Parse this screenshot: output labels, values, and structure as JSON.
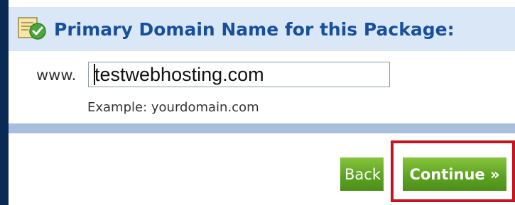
{
  "header": {
    "title": "Primary Domain Name for this Package:",
    "icon": "document-check-icon"
  },
  "domain": {
    "prefix": "www.",
    "value": "testwebhosting.com",
    "example": "Example: yourdomain.com"
  },
  "actions": {
    "back_label": "Back",
    "continue_label": "Continue »"
  },
  "colors": {
    "page_background": "#0a2a55",
    "header_background": "#d9e7f6",
    "title_color": "#184f9b",
    "separator_band": "#a8bedc",
    "button_green": "#5ea323",
    "highlight_border": "#c41422"
  }
}
